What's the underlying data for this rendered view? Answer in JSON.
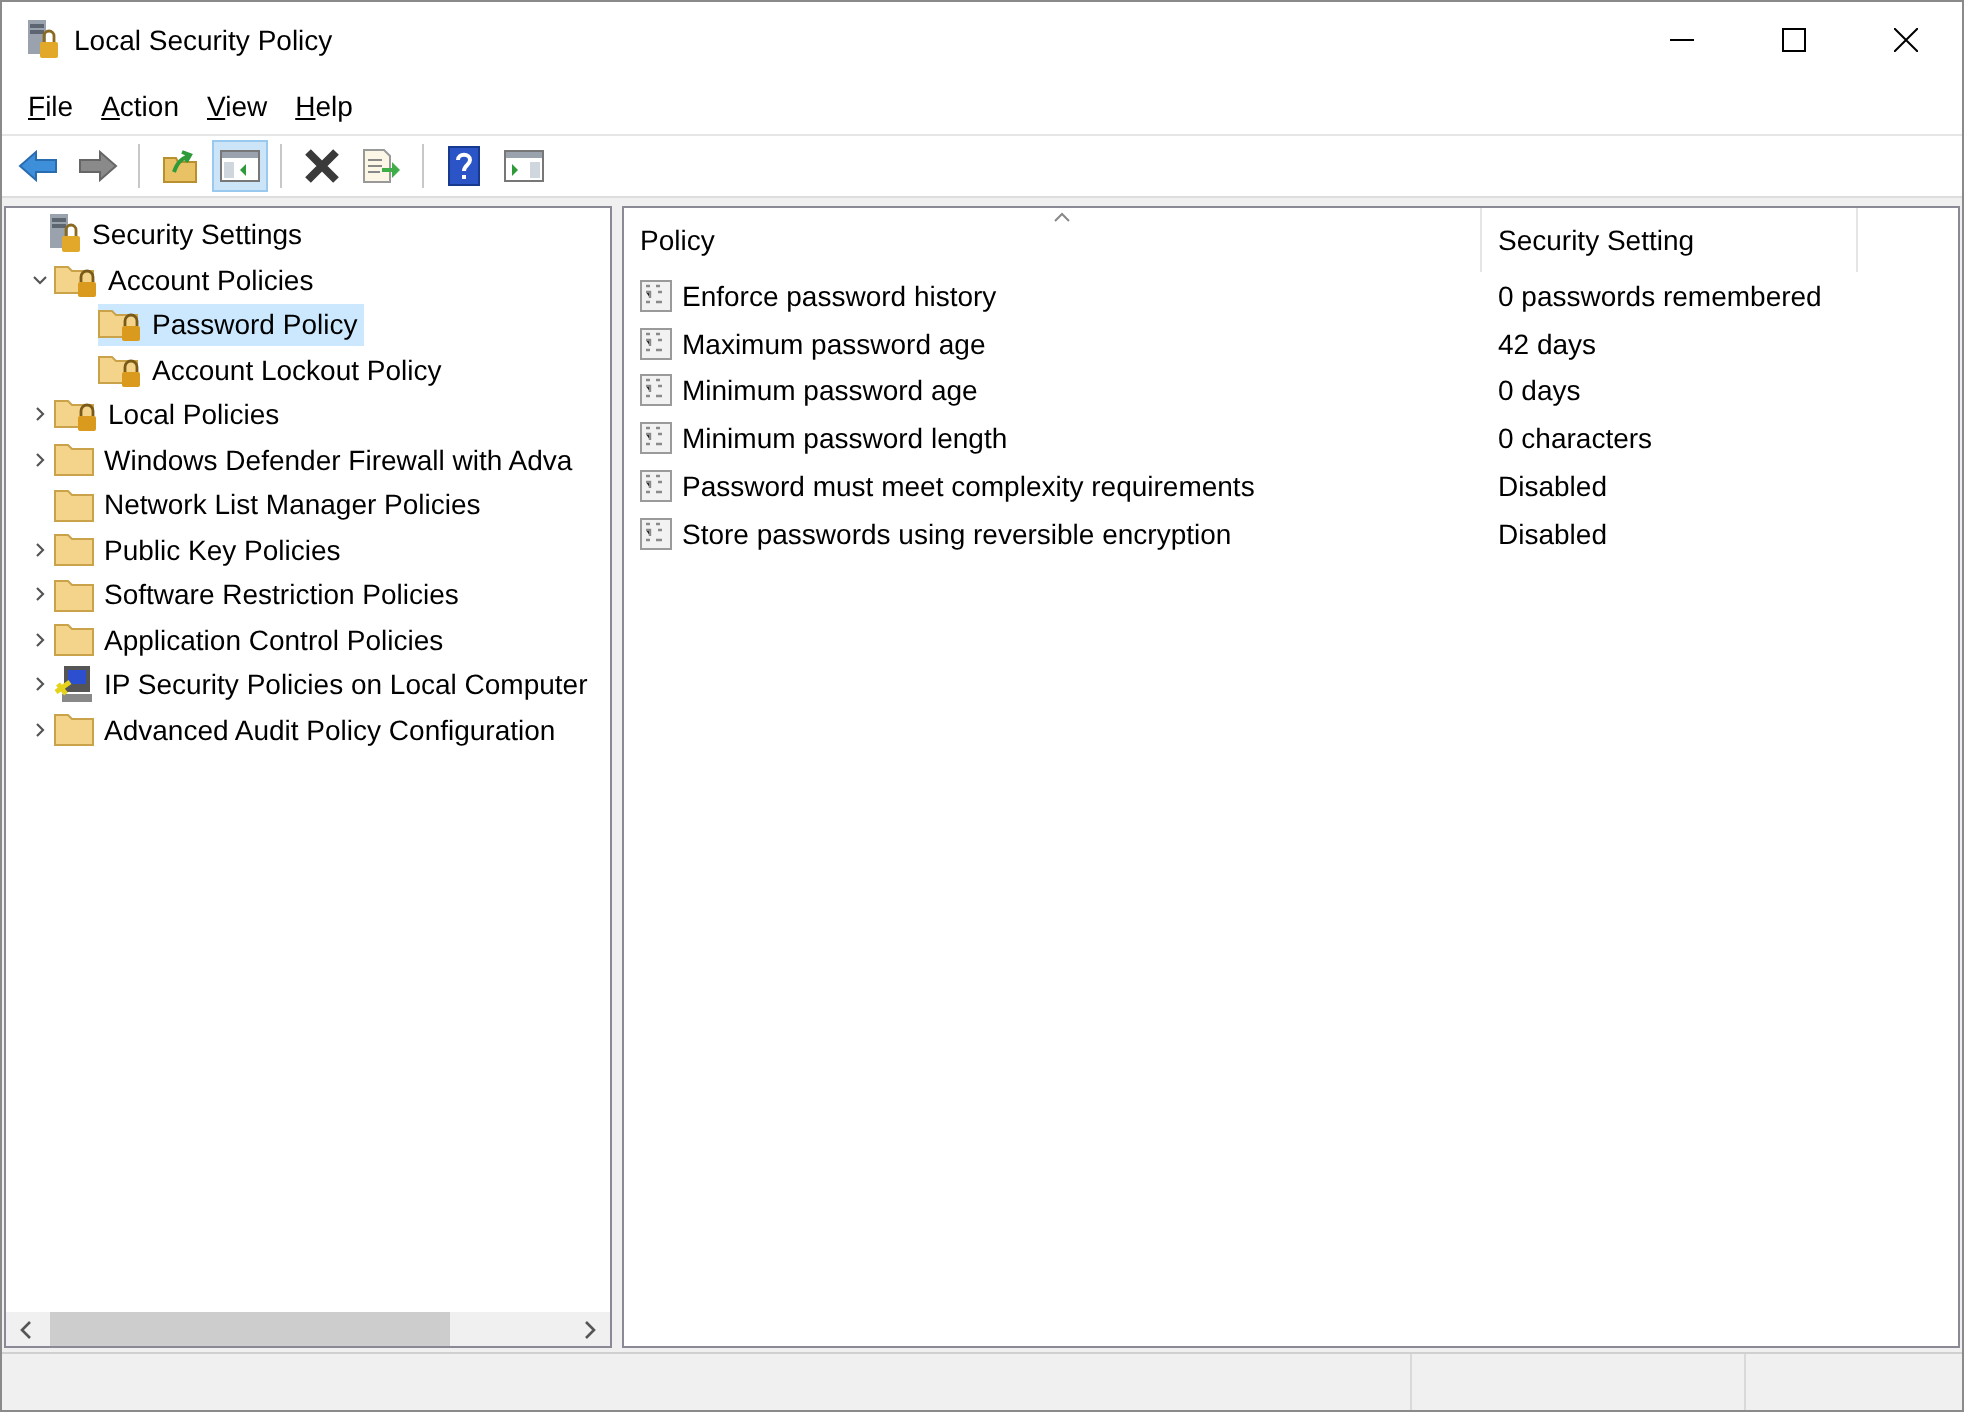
{
  "window": {
    "title": "Local Security Policy"
  },
  "menu": [
    {
      "label": "File"
    },
    {
      "label": "Action"
    },
    {
      "label": "View"
    },
    {
      "label": "Help"
    }
  ],
  "toolbar": [
    {
      "kind": "back",
      "pressed": false
    },
    {
      "kind": "forward",
      "pressed": false
    },
    {
      "kind": "sep"
    },
    {
      "kind": "up",
      "pressed": false
    },
    {
      "kind": "tree",
      "pressed": true
    },
    {
      "kind": "sep"
    },
    {
      "kind": "delete",
      "pressed": false
    },
    {
      "kind": "export",
      "pressed": false
    },
    {
      "kind": "sep"
    },
    {
      "kind": "help",
      "pressed": false
    },
    {
      "kind": "pane",
      "pressed": false
    }
  ],
  "tree": [
    {
      "label": "Security Settings",
      "kind": "server",
      "selected": false,
      "children": [
        {
          "label": "Account Policies",
          "kind": "lock-folder",
          "expanded": true,
          "selected": false,
          "children": [
            {
              "label": "Password Policy",
              "kind": "lock-folder",
              "selected": true
            },
            {
              "label": "Account Lockout Policy",
              "kind": "lock-folder",
              "selected": false
            }
          ]
        },
        {
          "label": "Local Policies",
          "kind": "lock-folder",
          "expanded": false,
          "selected": false
        },
        {
          "label": "Windows Defender Firewall with Adva",
          "kind": "folder",
          "expanded": false,
          "selected": false
        },
        {
          "label": "Network List Manager Policies",
          "kind": "folder",
          "selected": false
        },
        {
          "label": "Public Key Policies",
          "kind": "folder",
          "expanded": false,
          "selected": false
        },
        {
          "label": "Software Restriction Policies",
          "kind": "folder",
          "expanded": false,
          "selected": false
        },
        {
          "label": "Application Control Policies",
          "kind": "folder",
          "expanded": false,
          "selected": false
        },
        {
          "label": "IP Security Policies on Local Computer",
          "kind": "ip-computer",
          "expanded": false,
          "selected": false
        },
        {
          "label": "Advanced Audit Policy Configuration",
          "kind": "folder",
          "expanded": false,
          "selected": false
        }
      ]
    }
  ],
  "table": {
    "columns": [
      "Policy",
      "Security Setting"
    ],
    "rows": [
      {
        "policy": "Enforce password history",
        "setting": "0 passwords remembered"
      },
      {
        "policy": "Maximum password age",
        "setting": "42 days"
      },
      {
        "policy": "Minimum password age",
        "setting": "0 days"
      },
      {
        "policy": "Minimum password length",
        "setting": "0 characters"
      },
      {
        "policy": "Password must meet complexity requirements",
        "setting": "Disabled"
      },
      {
        "policy": "Store passwords using reversible encryption",
        "setting": "Disabled"
      }
    ]
  }
}
